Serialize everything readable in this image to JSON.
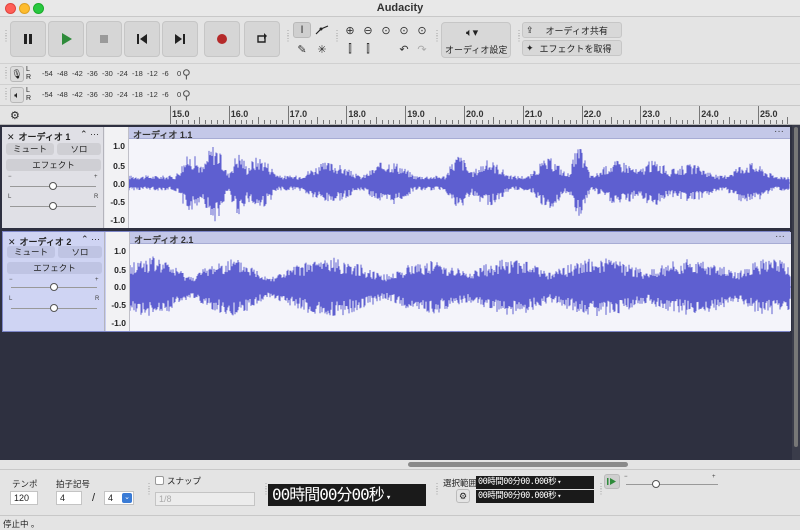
{
  "window": {
    "title": "Audacity"
  },
  "toolbar": {
    "audio_setup_label": "オーディオ設定",
    "share_audio_label": "オーディオ共有",
    "get_effects_label": "エフェクトを取得"
  },
  "meters": {
    "record_ticks": [
      "-54",
      "-48",
      "-42",
      "-36",
      "-30",
      "-24",
      "-18",
      "-12",
      "-6",
      "0"
    ],
    "play_ticks": [
      "-54",
      "-48",
      "-42",
      "-36",
      "-30",
      "-24",
      "-18",
      "-12",
      "-6",
      "0"
    ],
    "l": "L",
    "r": "R"
  },
  "ruler": {
    "labels": [
      "15.0",
      "16.0",
      "17.0",
      "18.0",
      "19.0",
      "20.0",
      "21.0",
      "22.0",
      "23.0",
      "24.0",
      "25.0"
    ]
  },
  "tracks": [
    {
      "name": "オーディオ 1",
      "clip_title": "オーディオ 1.1",
      "mute": "ミュート",
      "solo": "ソロ",
      "effects": "エフェクト",
      "scale": [
        "1.0",
        "0.5",
        "0.0",
        "-0.5",
        "-1.0"
      ],
      "gain_minus": "−",
      "gain_plus": "+",
      "pan_l": "L",
      "pan_r": "R"
    },
    {
      "name": "オーディオ 2",
      "clip_title": "オーディオ 2.1",
      "mute": "ミュート",
      "solo": "ソロ",
      "effects": "エフェクト",
      "scale": [
        "1.0",
        "0.5",
        "0.0",
        "-0.5",
        "-1.0"
      ],
      "gain_minus": "−",
      "gain_plus": "+",
      "pan_l": "L",
      "pan_r": "R"
    }
  ],
  "bottom": {
    "tempo_label": "テンポ",
    "tempo_value": "120",
    "time_sig_label": "拍子記号",
    "time_sig_num": "4",
    "time_sig_slash": "/",
    "time_sig_den": "4",
    "snap_label": "スナップ",
    "snap_value": "1/8",
    "time_display": "00時間00分00秒",
    "selection_label": "選択範囲",
    "sel_start": "00時間00分00.000秒",
    "sel_end": "00時間00分00.000秒"
  },
  "status": {
    "text": "停止中 。"
  },
  "colors": {
    "waveform": "#5e5fd0",
    "track_bg": "#2e3040",
    "selected_track": "#c8cdf0"
  }
}
